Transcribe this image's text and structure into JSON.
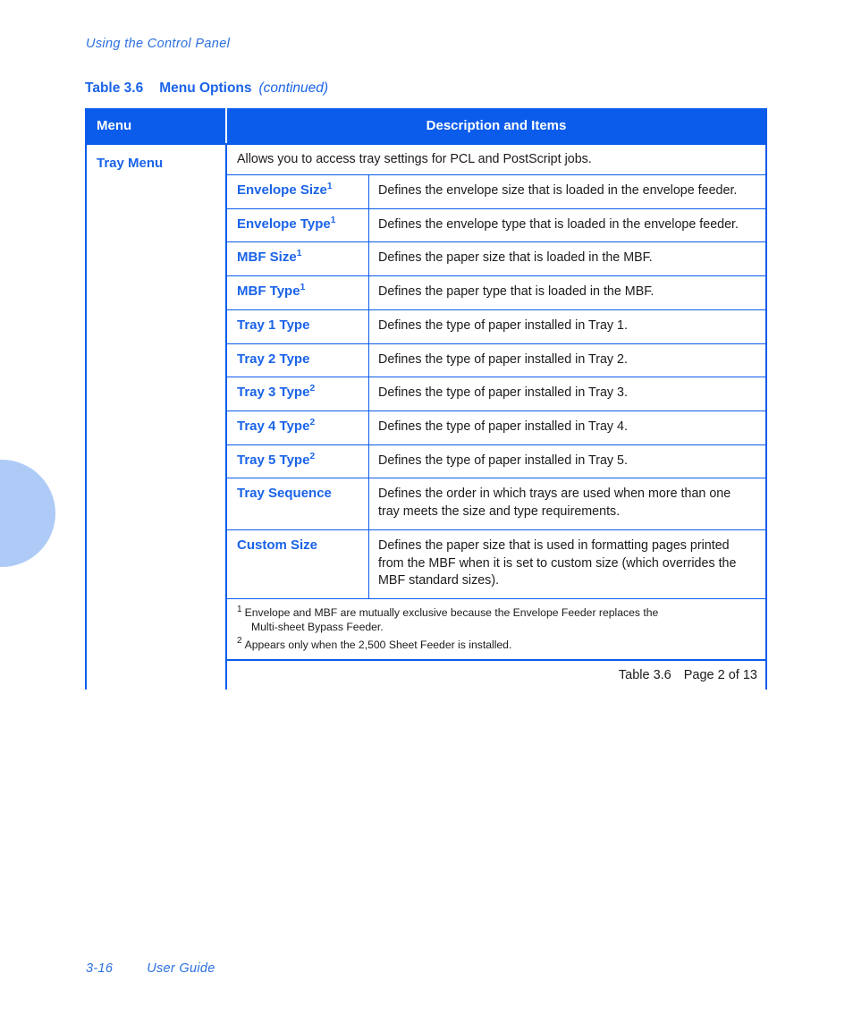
{
  "page": {
    "running_head": "Using the Control Panel",
    "footer_folio": "3-16",
    "footer_doc_title": "User Guide"
  },
  "caption": {
    "table_number": "Table 3.6",
    "title": "Menu Options",
    "continued": "(continued)"
  },
  "table": {
    "columns": {
      "menu": "Menu",
      "description": "Description and Items"
    },
    "menu_name": "Tray Menu",
    "intro": "Allows you to access tray settings for PCL and PostScript jobs.",
    "items": [
      {
        "name": "Envelope Size",
        "footnote_mark": "1",
        "description": "Defines the envelope size that is loaded in the envelope feeder."
      },
      {
        "name": "Envelope Type",
        "footnote_mark": "1",
        "description": "Defines the envelope type that is loaded in the envelope feeder."
      },
      {
        "name": "MBF Size",
        "footnote_mark": "1",
        "description": "Defines the paper size that is loaded in the MBF."
      },
      {
        "name": "MBF Type",
        "footnote_mark": "1",
        "description": "Defines the paper type that is loaded in the MBF."
      },
      {
        "name": "Tray 1 Type",
        "footnote_mark": "",
        "description": "Defines the type of paper installed in Tray 1."
      },
      {
        "name": "Tray 2 Type",
        "footnote_mark": "",
        "description": "Defines the type of paper installed in Tray 2."
      },
      {
        "name": "Tray 3 Type",
        "footnote_mark": "2",
        "description": "Defines the type of paper installed in Tray 3."
      },
      {
        "name": "Tray 4 Type",
        "footnote_mark": "2",
        "description": "Defines the type of paper installed in Tray 4."
      },
      {
        "name": "Tray 5 Type",
        "footnote_mark": "2",
        "description": "Defines the type of paper installed in Tray 5."
      },
      {
        "name": "Tray Sequence",
        "footnote_mark": "",
        "description": "Defines the order in which trays are used when more than one tray meets the size and type requirements."
      },
      {
        "name": "Custom Size",
        "footnote_mark": "",
        "description": "Defines the paper size that is used in formatting pages printed from the MBF when it is set to custom size (which overrides the MBF standard sizes)."
      }
    ],
    "footnotes": [
      {
        "mark": "1",
        "text": "Envelope and MBF are mutually exclusive because the Envelope Feeder replaces the",
        "continuation": "Multi-sheet Bypass Feeder."
      },
      {
        "mark": "2",
        "text": "Appears only when the 2,500 Sheet Feeder is installed.",
        "continuation": ""
      }
    ],
    "footer": {
      "table_label": "Table 3.6",
      "page_label": "Page 2 of 13"
    }
  },
  "colors": {
    "header_blue": "#0b5ceb",
    "text_blue": "#1a63e8",
    "running_head_blue": "#2b6fe0",
    "decoration_blue": "#aecbf7",
    "body_text": "#1b1b1b"
  }
}
